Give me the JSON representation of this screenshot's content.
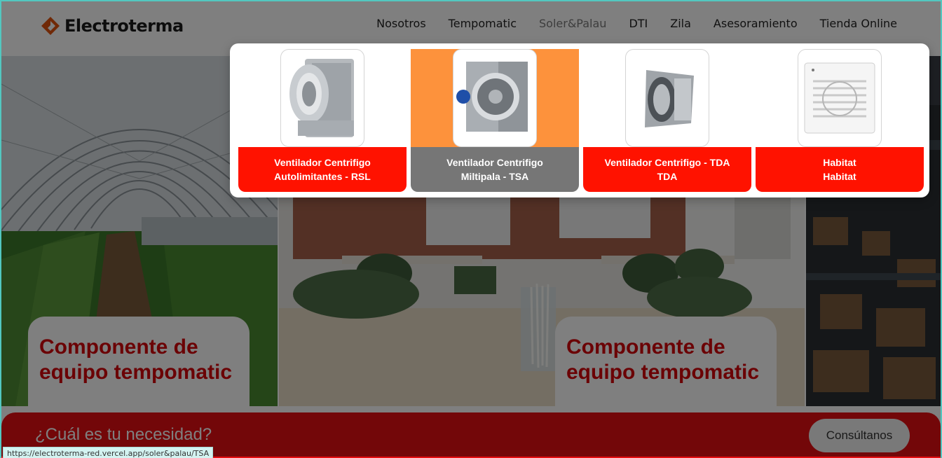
{
  "brand": {
    "name": "Electroterma",
    "logo_color": "#e0520f"
  },
  "nav": {
    "items": [
      {
        "label": "Nosotros"
      },
      {
        "label": "Tempomatic"
      },
      {
        "label": "Soler&Palau",
        "active": true
      },
      {
        "label": "DTI"
      },
      {
        "label": "Zila"
      },
      {
        "label": "Asesoramiento"
      },
      {
        "label": "Tienda Online"
      }
    ]
  },
  "dropdown": {
    "products": [
      {
        "line1": "Ventilador Centrifigo",
        "line2": "Autolimitantes - RSL",
        "icon": "centrifugal-fan-rsl-image"
      },
      {
        "line1": "Ventilador Centrifigo",
        "line2": "Miltipala - TSA",
        "icon": "centrifugal-fan-tsa-image",
        "hover": true
      },
      {
        "line1": "Ventilador Centrifigo - TDA",
        "line2": "TDA",
        "icon": "centrifugal-fan-tda-image"
      },
      {
        "line1": "Habitat",
        "line2": "Habitat",
        "icon": "habitat-fan-image"
      }
    ],
    "colors": {
      "label_bg": "#ff1200",
      "hover_label_bg": "#767676",
      "hover_image_bg": "#fd923c"
    }
  },
  "hero": {
    "cards": [
      {
        "title_line1": "Componente de",
        "title_line2": "equipo tempomatic"
      },
      {
        "title_line1": "Componente de",
        "title_line2": "equipo tempomatic"
      }
    ],
    "title_color": "#d6050a"
  },
  "cta": {
    "title": "¿Cuál es tu necesidad?",
    "button_label": "Consúltanos",
    "background": "#e60e12"
  },
  "status_bar": {
    "url": "https://electroterma-red.vercel.app/soler&palau/TSA"
  }
}
